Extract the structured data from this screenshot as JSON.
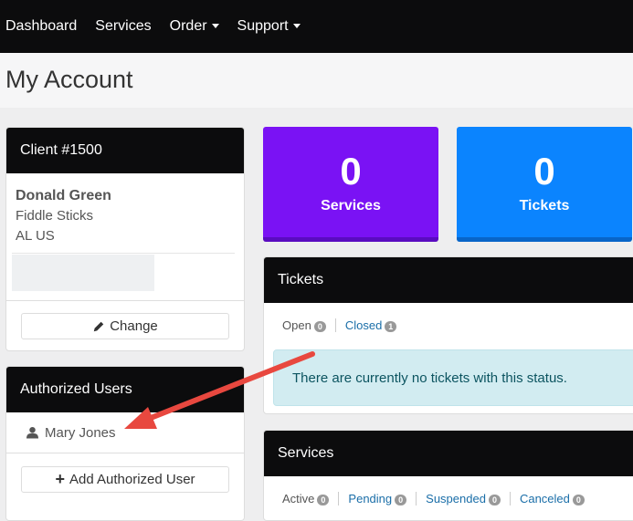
{
  "nav": {
    "items": [
      {
        "label": "Dashboard"
      },
      {
        "label": "Services"
      },
      {
        "label": "Order"
      },
      {
        "label": "Support"
      }
    ]
  },
  "page": {
    "title": "My Account"
  },
  "client": {
    "header": "Client #1500",
    "name": "Donald Green",
    "company": "Fiddle Sticks",
    "location": "AL US",
    "change_label": "Change"
  },
  "auth": {
    "header": "Authorized Users",
    "user": "Mary Jones",
    "add_label": "Add Authorized User"
  },
  "stats": [
    {
      "value": "0",
      "label": "Services",
      "color": "#7a12f4"
    },
    {
      "value": "0",
      "label": "Tickets",
      "color": "#0b84fe"
    }
  ],
  "tickets": {
    "header": "Tickets",
    "tabs": [
      {
        "label": "Open",
        "count": "0"
      },
      {
        "label": "Closed",
        "count": "1"
      }
    ],
    "alert": "There are currently no tickets with this status."
  },
  "services": {
    "header": "Services",
    "tabs": [
      {
        "label": "Active",
        "count": "0"
      },
      {
        "label": "Pending",
        "count": "0"
      },
      {
        "label": "Suspended",
        "count": "0"
      },
      {
        "label": "Canceled",
        "count": "0"
      }
    ]
  }
}
